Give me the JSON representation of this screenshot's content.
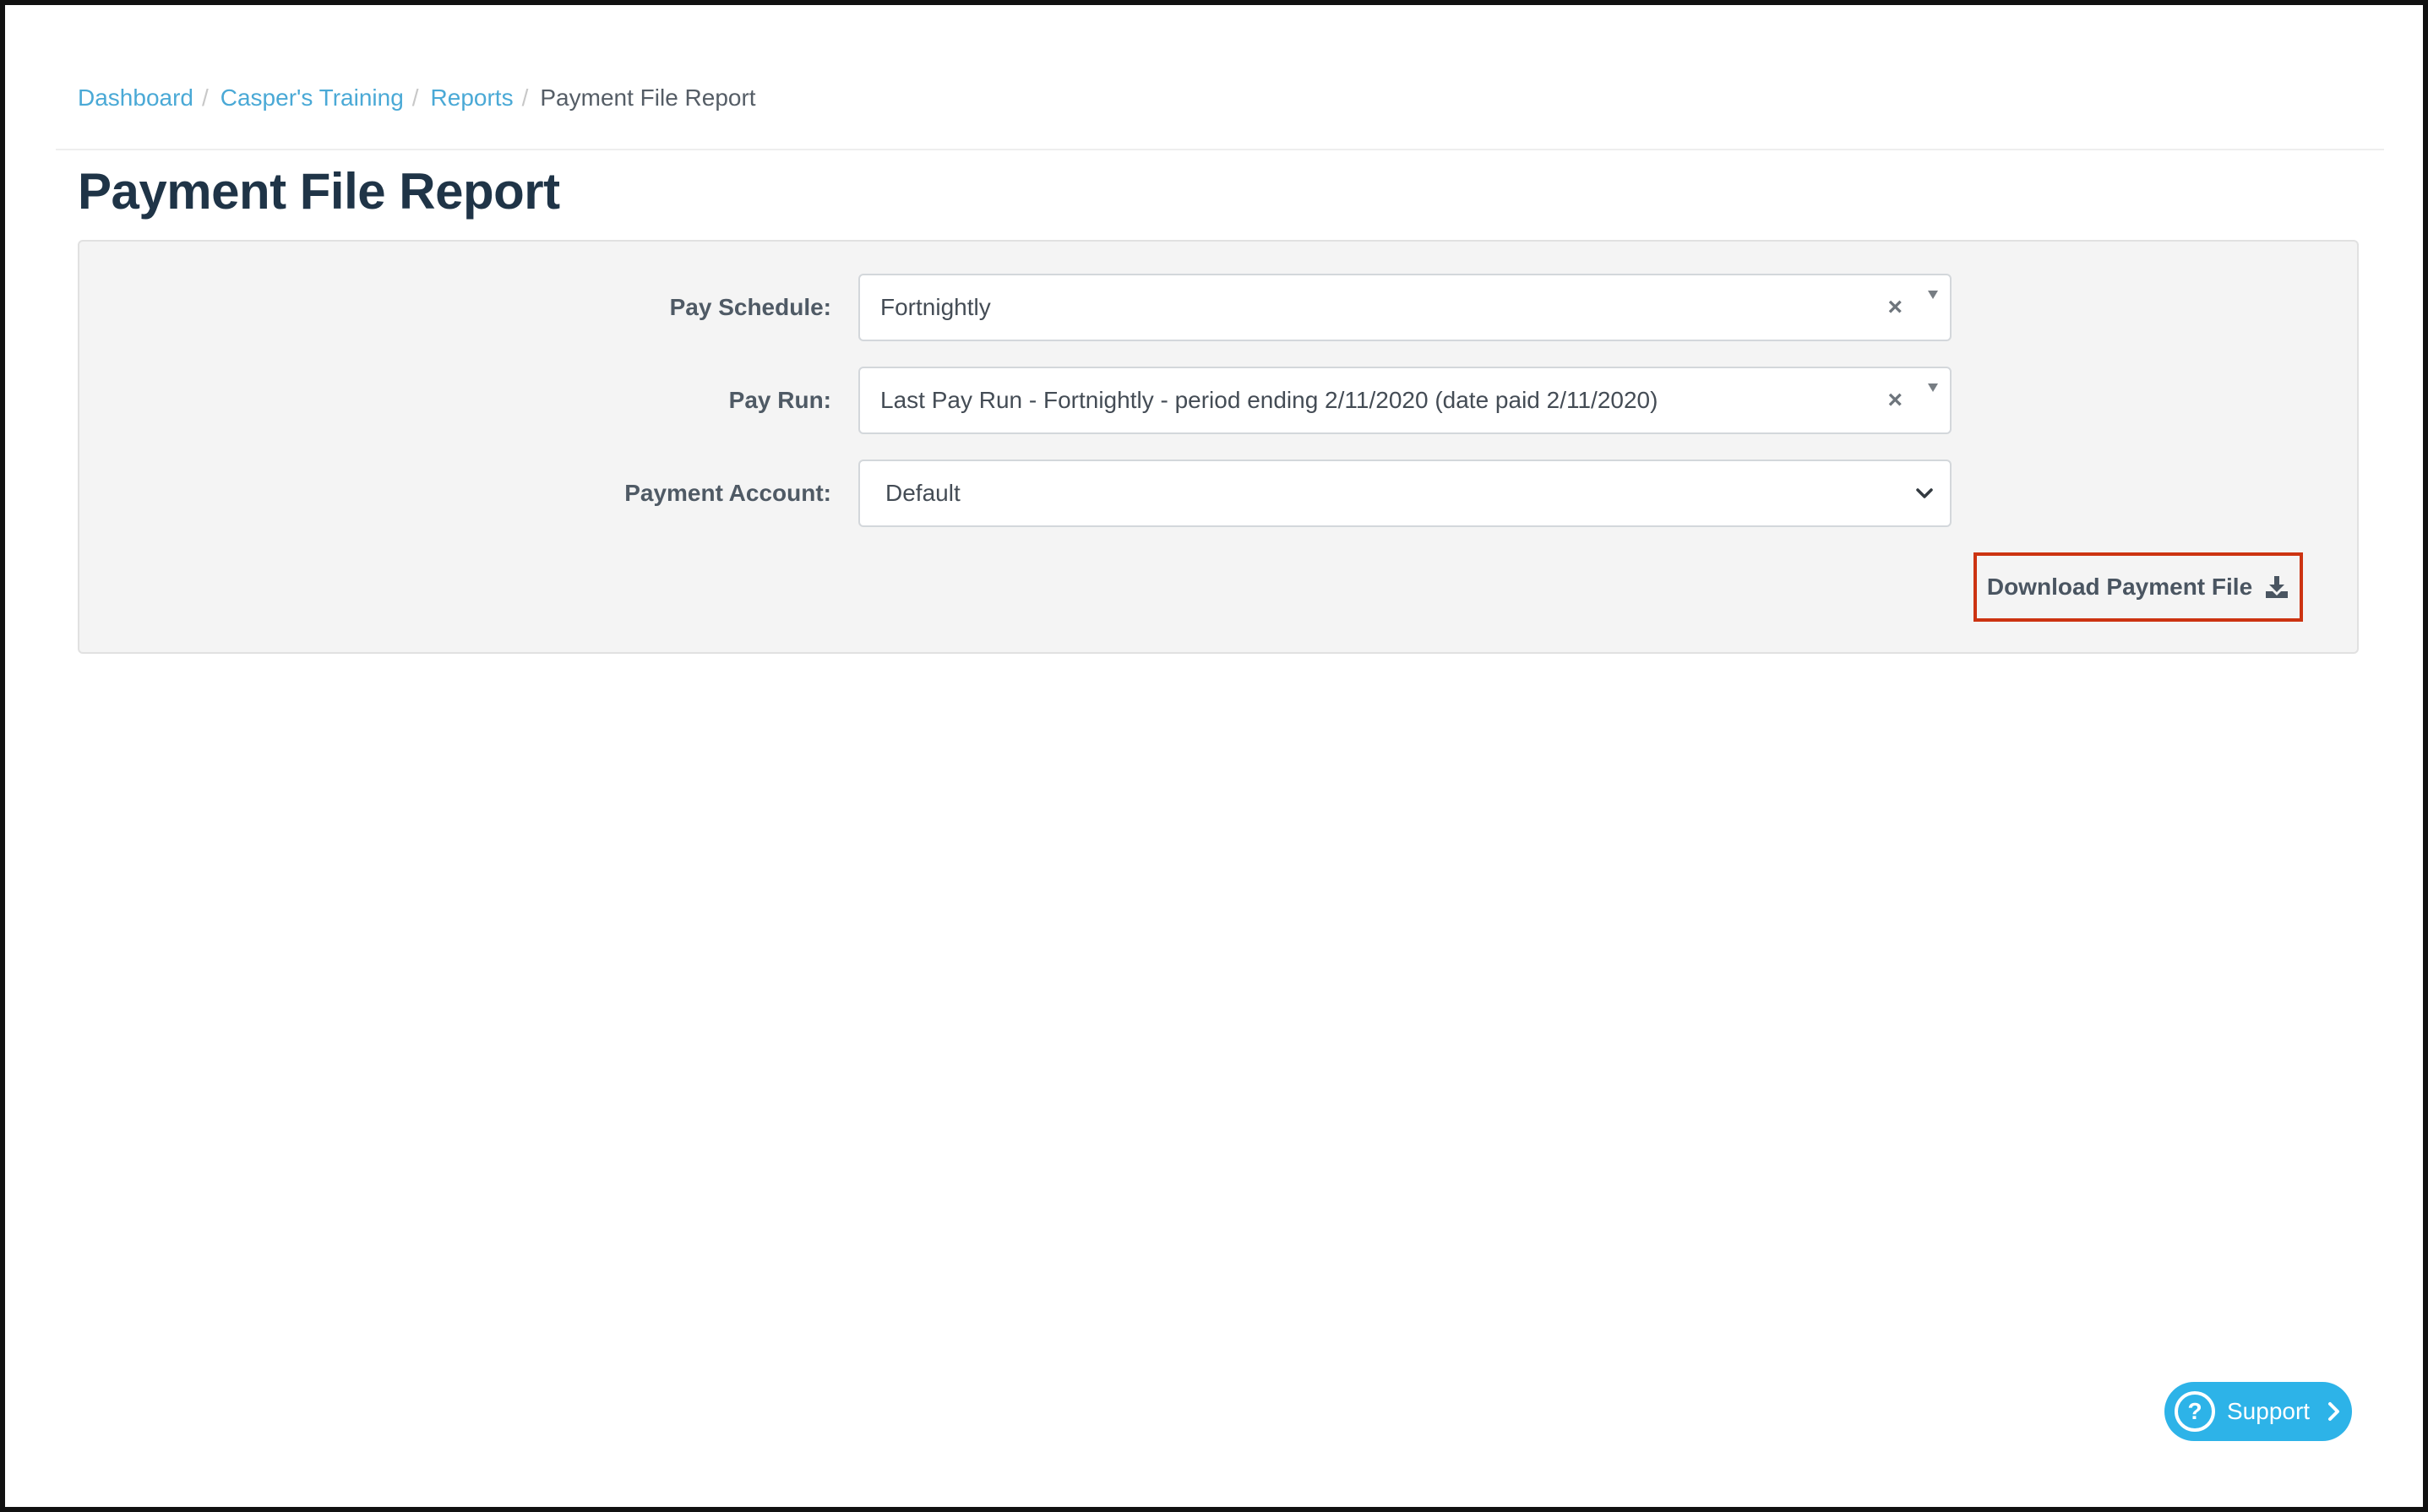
{
  "breadcrumb": {
    "items": [
      "Dashboard",
      "Casper's Training",
      "Reports"
    ],
    "separator": "/",
    "current": "Payment File Report"
  },
  "page_title": "Payment File Report",
  "form": {
    "pay_schedule": {
      "label": "Pay Schedule:",
      "value": "Fortnightly",
      "clear": "×"
    },
    "pay_run": {
      "label": "Pay Run:",
      "value": "Last Pay Run - Fortnightly - period ending 2/11/2020 (date paid 2/11/2020)",
      "clear": "×"
    },
    "payment_account": {
      "label": "Payment Account:",
      "value": "Default"
    }
  },
  "download_button": {
    "label": "Download Payment File",
    "icon": "download-icon"
  },
  "support": {
    "label": "Support",
    "icon": "help-circle-icon",
    "help_glyph": "?"
  },
  "colors": {
    "link": "#4aa9d6",
    "title": "#1f3447",
    "highlight_border": "#cc3311",
    "support_bg": "#2db3e8",
    "panel_bg": "#f4f4f4"
  }
}
